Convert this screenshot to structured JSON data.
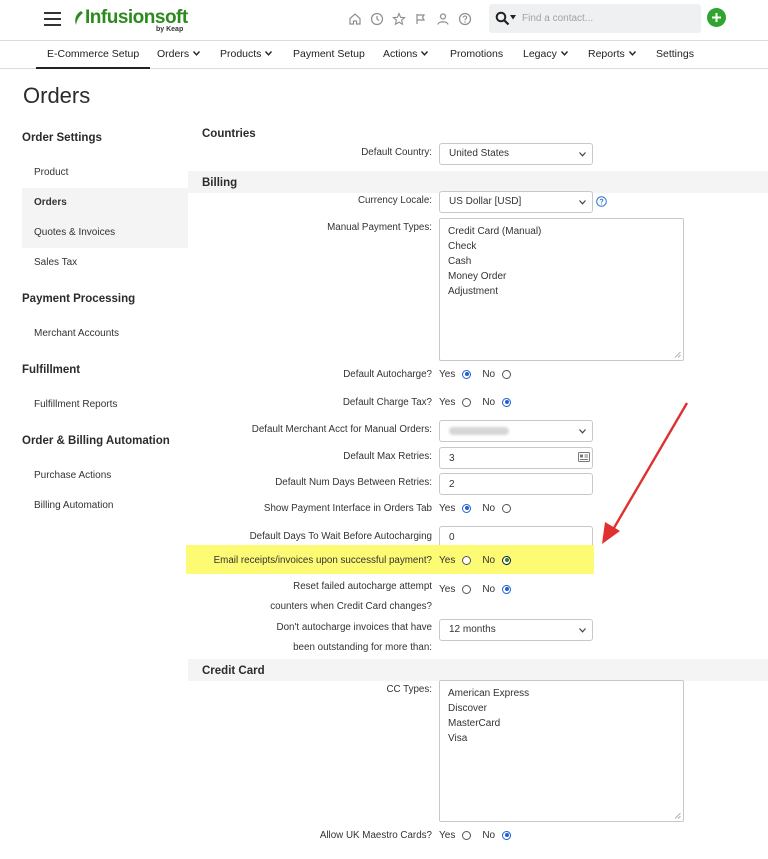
{
  "app": {
    "logo_text": "Infusionsoft",
    "logo_sub": "by Keap",
    "brand_color": "#2c8a1e",
    "top_icons": [
      "home-icon",
      "clock-icon",
      "star-icon",
      "flag-icon",
      "person-icon",
      "help-icon"
    ],
    "search": {
      "placeholder": "Find a contact..."
    },
    "add_button_color": "#2fa52f"
  },
  "nav": {
    "items": [
      {
        "label": "E-Commerce Setup",
        "dropdown": false,
        "active": true
      },
      {
        "label": "Orders",
        "dropdown": true
      },
      {
        "label": "Products",
        "dropdown": true
      },
      {
        "label": "Payment Setup",
        "dropdown": false
      },
      {
        "label": "Actions",
        "dropdown": true
      },
      {
        "label": "Promotions",
        "dropdown": false
      },
      {
        "label": "Legacy",
        "dropdown": true
      },
      {
        "label": "Reports",
        "dropdown": true
      },
      {
        "label": "Settings",
        "dropdown": false
      }
    ]
  },
  "page": {
    "title": "Orders"
  },
  "sidebar": {
    "groups": [
      {
        "heading": "Order Settings",
        "items": [
          "Product",
          "Orders",
          "Quotes & Invoices",
          "Sales Tax"
        ]
      },
      {
        "heading": "Payment Processing",
        "items": [
          "Merchant Accounts"
        ]
      },
      {
        "heading": "Fulfillment",
        "items": [
          "Fulfillment Reports"
        ]
      },
      {
        "heading": "Order & Billing Automation",
        "items": [
          "Purchase Actions",
          "Billing Automation"
        ]
      }
    ],
    "active_item": "Orders"
  },
  "countries": {
    "heading": "Countries",
    "default_country_label": "Default Country:",
    "default_country_value": "United States"
  },
  "billing": {
    "heading": "Billing",
    "currency_label": "Currency Locale:",
    "currency_value": "US Dollar [USD]",
    "manual_payment_label": "Manual Payment Types:",
    "manual_payment_types": [
      "Credit Card (Manual)",
      "Check",
      "Cash",
      "Money Order",
      "Adjustment"
    ],
    "autocharge_label": "Default Autocharge?",
    "autocharge_value": "Yes",
    "charge_tax_label": "Default Charge Tax?",
    "charge_tax_value": "No",
    "merchant_acct_label": "Default Merchant Acct for Manual Orders:",
    "max_retries_label": "Default Max Retries:",
    "max_retries_value": "3",
    "days_between_label": "Default Num Days Between Retries:",
    "days_between_value": "2",
    "show_payment_label": "Show Payment Interface in Orders Tab",
    "show_payment_value": "Yes",
    "days_wait_label": "Default Days To Wait Before Autocharging",
    "days_wait_value": "0",
    "email_receipts_label": "Email receipts/invoices upon successful payment?",
    "email_receipts_value": "No",
    "reset_failed_label_1": "Reset failed autocharge attempt",
    "reset_failed_label_2": "counters when Credit Card changes?",
    "reset_failed_value": "No",
    "dont_autocharge_label_1": "Don't autocharge invoices that have",
    "dont_autocharge_label_2": "been outstanding for more than:",
    "dont_autocharge_value": "12 months",
    "yes": "Yes",
    "no": "No"
  },
  "credit_card": {
    "heading": "Credit Card",
    "cc_types_label": "CC Types:",
    "cc_types": [
      "American Express",
      "Discover",
      "MasterCard",
      "Visa"
    ],
    "maestro_label": "Allow UK Maestro Cards?",
    "maestro_value": "No"
  },
  "annotation": {
    "highlight_color": "#fdfa73",
    "arrow_color": "#e03030"
  }
}
